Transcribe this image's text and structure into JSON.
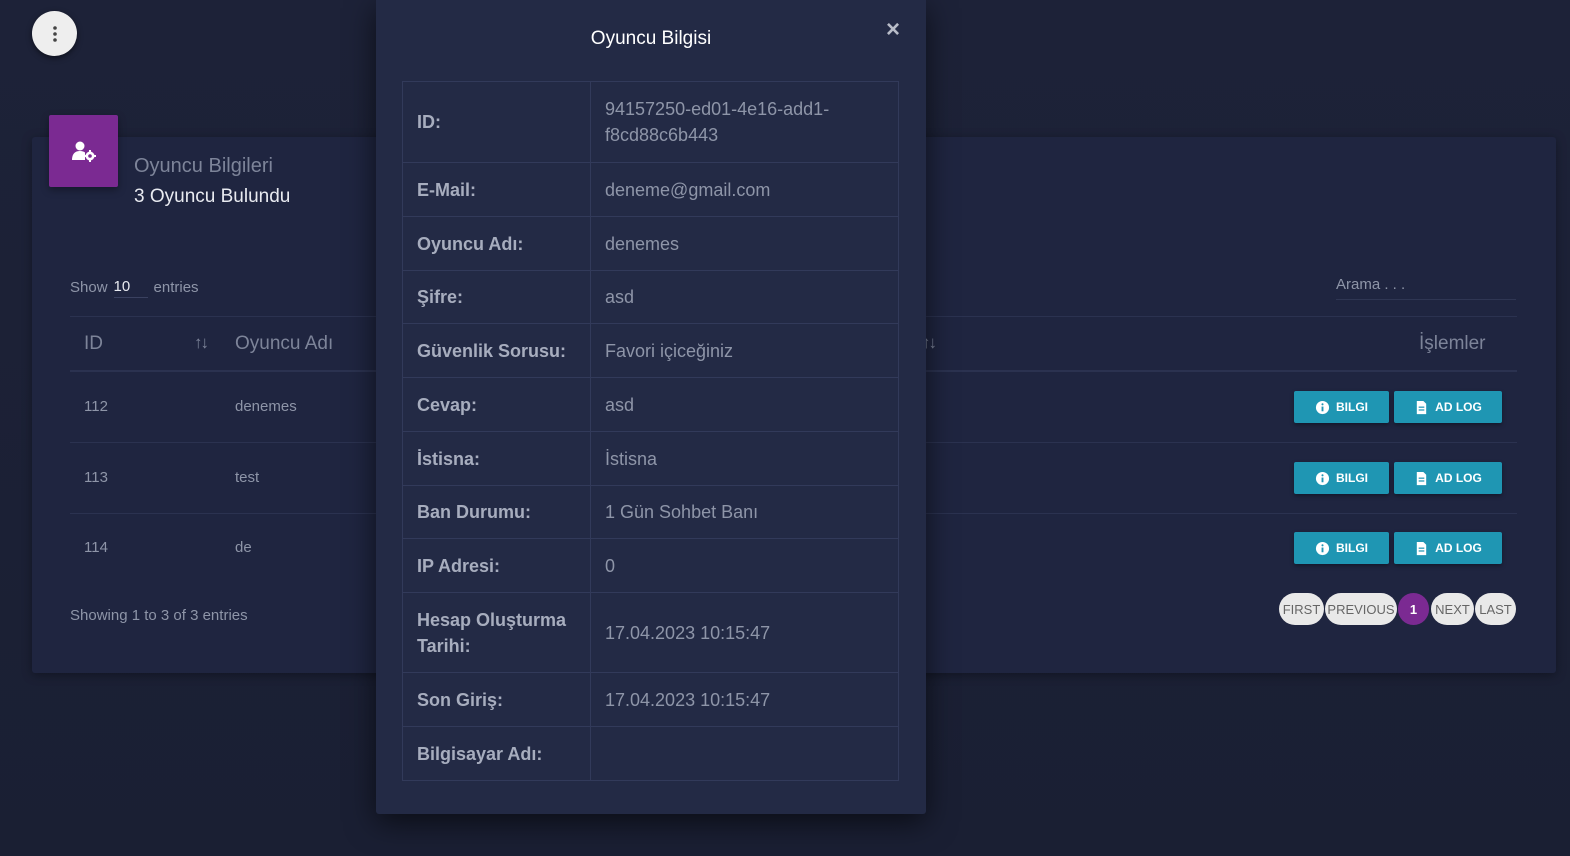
{
  "menu": {
    "icon": "more-vert-icon"
  },
  "card": {
    "icon": "user-gear-icon",
    "accent": "#7b2a92",
    "subtitle": "Oyuncu Bilgileri",
    "title": "3 Oyuncu Bulundu"
  },
  "table_controls": {
    "show_label": "Show",
    "length_value": "10",
    "entries_label": "entries",
    "search_placeholder": "Arama . . ."
  },
  "table": {
    "columns": {
      "id": "ID",
      "name": "Oyuncu Adı",
      "actions": "İşlemler"
    },
    "rows": [
      {
        "id": "112",
        "name": "denemes"
      },
      {
        "id": "113",
        "name": "test"
      },
      {
        "id": "114",
        "name": "de"
      }
    ],
    "info_button": "BILGI",
    "log_button": "AD LOG",
    "button_color": "#1f96b3"
  },
  "footer": {
    "showing": "Showing 1 to 3 of 3 entries",
    "pager": {
      "first": "FIRST",
      "previous": "PREVIOUS",
      "current": "1",
      "next": "NEXT",
      "last": "LAST"
    }
  },
  "modal": {
    "title": "Oyuncu Bilgisi",
    "close": "×",
    "fields": [
      {
        "label": "ID:",
        "value": "94157250-ed01-4e16-add1-f8cd88c6b443"
      },
      {
        "label": "E-Mail:",
        "value": "deneme@gmail.com"
      },
      {
        "label": "Oyuncu Adı:",
        "value": "denemes"
      },
      {
        "label": "Şifre:",
        "value": "asd"
      },
      {
        "label": "Güvenlik Sorusu:",
        "value": "Favori içiceğiniz"
      },
      {
        "label": "Cevap:",
        "value": "asd"
      },
      {
        "label": "İstisna:",
        "value": "İstisna"
      },
      {
        "label": "Ban Durumu:",
        "value": "1 Gün Sohbet Banı"
      },
      {
        "label": "IP Adresi:",
        "value": "0"
      },
      {
        "label": "Hesap Oluşturma Tarihi:",
        "value": "17.04.2023 10:15:47"
      },
      {
        "label": "Son Giriş:",
        "value": "17.04.2023 10:15:47"
      },
      {
        "label": "Bilgisayar Adı:",
        "value": ""
      }
    ]
  }
}
